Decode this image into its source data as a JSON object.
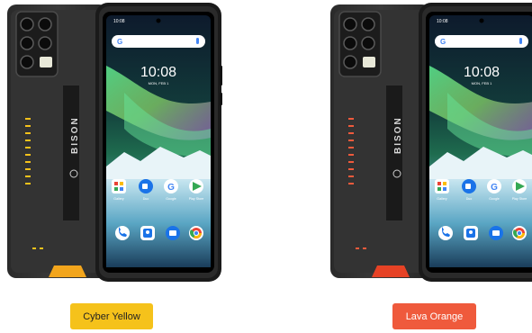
{
  "variants": [
    {
      "label": "Cyber Yellow",
      "accent": "#f5c21b",
      "button_color": "#f5c21b",
      "button_text_color": "#222222",
      "bumper_color": "#f2a51c"
    },
    {
      "label": "Lava Orange",
      "accent": "#ef5a3c",
      "button_color": "#ef5a3c",
      "button_text_color": "#ffffff",
      "bumper_color": "#e64225"
    }
  ],
  "phone": {
    "brand": "BISON",
    "status_time": "10:08",
    "lock_time": "10:08",
    "lock_date": "MON, FEB 1",
    "apps_row1": [
      "Gallery",
      "Duo",
      "Google",
      "Play Store"
    ],
    "apps_row1_icons": [
      "gallery-folder-icon",
      "duo-video-icon",
      "google-icon",
      "play-store-icon"
    ],
    "dock_icons": [
      "phone-icon",
      "contacts-icon",
      "messages-icon",
      "chrome-icon"
    ]
  }
}
